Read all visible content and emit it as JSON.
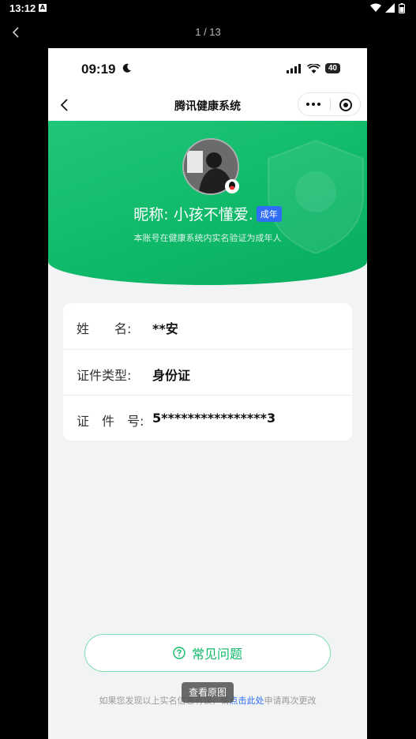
{
  "system": {
    "time": "13:12",
    "notif": "A"
  },
  "viewer": {
    "counter": "1 / 13",
    "view_original": "查看原图"
  },
  "phone": {
    "time": "09:19",
    "battery": "40",
    "nav_title": "腾讯健康系统"
  },
  "hero": {
    "nickname": "昵称: 小孩不懂爱.",
    "badge": "成年",
    "subtitle": "本账号在健康系统内实名验证为成年人"
  },
  "info": {
    "rows": [
      {
        "label": "姓　　名:",
        "value": "**安"
      },
      {
        "label": "证件类型:",
        "value": "身份证"
      },
      {
        "label": "证　件　号:",
        "value": "5****************3"
      }
    ]
  },
  "faq": {
    "label": "常见问题"
  },
  "footer": {
    "prefix": "如果您发现以上实名信息有误，请",
    "link": "点击此处",
    "suffix": "申请再次更改"
  },
  "colors": {
    "brand_green": "#12b96a",
    "badge_blue": "#2f6df6"
  }
}
